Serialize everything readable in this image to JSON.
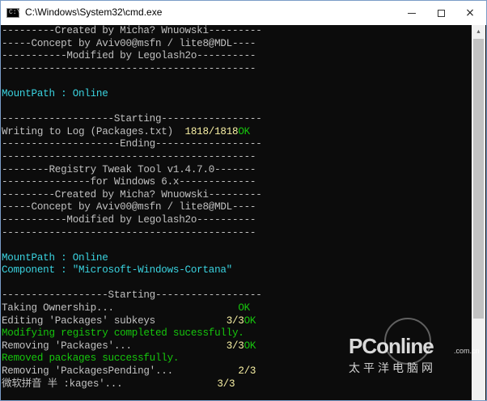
{
  "window": {
    "title": "C:\\Windows\\System32\\cmd.exe",
    "icon": "cmd-icon"
  },
  "controls": {
    "minimize": "minimize-icon",
    "maximize": "maximize-icon",
    "close": "×"
  },
  "colors": {
    "grey": "#c0c0c0",
    "cyan": "#3ad3e0",
    "green": "#16c60c",
    "yellow": "#f9f1a5"
  },
  "console_lines": [
    {
      "segments": [
        {
          "text": "---------Created by Micha? Wnuowski---------",
          "color": "grey"
        }
      ]
    },
    {
      "segments": [
        {
          "text": "-----Concept by Aviv00@msfn / lite8@MDL----",
          "color": "grey"
        }
      ]
    },
    {
      "segments": [
        {
          "text": "-----------Modified by Legolash2o----------",
          "color": "grey"
        }
      ]
    },
    {
      "segments": [
        {
          "text": "-------------------------------------------",
          "color": "grey"
        }
      ]
    },
    {
      "segments": [
        {
          "text": "",
          "color": "grey"
        }
      ]
    },
    {
      "segments": [
        {
          "text": "MountPath : Online",
          "color": "cyan"
        }
      ]
    },
    {
      "segments": [
        {
          "text": "",
          "color": "grey"
        }
      ]
    },
    {
      "segments": [
        {
          "text": "-------------------Starting-----------------",
          "color": "grey"
        }
      ]
    },
    {
      "segments": [
        {
          "text": "Writing to Log (Packages.txt)  ",
          "color": "grey"
        },
        {
          "text": "1818/1818",
          "color": "yellow"
        },
        {
          "text": "OK",
          "color": "green"
        }
      ]
    },
    {
      "segments": [
        {
          "text": "--------------------Ending------------------",
          "color": "grey"
        }
      ]
    },
    {
      "segments": [
        {
          "text": "-------------------------------------------",
          "color": "grey"
        }
      ]
    },
    {
      "segments": [
        {
          "text": "--------Registry Tweak Tool v1.4.7.0-------",
          "color": "grey"
        }
      ]
    },
    {
      "segments": [
        {
          "text": "---------------for Windows 6.x-------------",
          "color": "grey"
        }
      ]
    },
    {
      "segments": [
        {
          "text": "---------Created by Micha? Wnuowski---------",
          "color": "grey"
        }
      ]
    },
    {
      "segments": [
        {
          "text": "-----Concept by Aviv00@msfn / lite8@MDL----",
          "color": "grey"
        }
      ]
    },
    {
      "segments": [
        {
          "text": "-----------Modified by Legolash2o----------",
          "color": "grey"
        }
      ]
    },
    {
      "segments": [
        {
          "text": "-------------------------------------------",
          "color": "grey"
        }
      ]
    },
    {
      "segments": [
        {
          "text": "",
          "color": "grey"
        }
      ]
    },
    {
      "segments": [
        {
          "text": "MountPath : Online",
          "color": "cyan"
        }
      ]
    },
    {
      "segments": [
        {
          "text": "Component : \"Microsoft-Windows-Cortana\"",
          "color": "cyan"
        }
      ]
    },
    {
      "segments": [
        {
          "text": "",
          "color": "grey"
        }
      ]
    },
    {
      "segments": [
        {
          "text": "------------------Starting------------------",
          "color": "grey"
        }
      ]
    },
    {
      "segments": [
        {
          "text": "Taking Ownership...                     ",
          "color": "grey"
        },
        {
          "text": "OK",
          "color": "green"
        }
      ]
    },
    {
      "segments": [
        {
          "text": "Editing 'Packages' subkeys            ",
          "color": "grey"
        },
        {
          "text": "3/3",
          "color": "yellow"
        },
        {
          "text": "OK",
          "color": "green"
        }
      ]
    },
    {
      "segments": [
        {
          "text": "Modifying registry completed sucessfully.",
          "color": "green"
        }
      ]
    },
    {
      "segments": [
        {
          "text": "Removing 'Packages'...                ",
          "color": "grey"
        },
        {
          "text": "3/3",
          "color": "yellow"
        },
        {
          "text": "OK",
          "color": "green"
        }
      ]
    },
    {
      "segments": [
        {
          "text": "Removed packages successfully.",
          "color": "green"
        }
      ]
    },
    {
      "segments": [
        {
          "text": "Removing 'PackagesPending'...           ",
          "color": "grey"
        },
        {
          "text": "2/3",
          "color": "yellow"
        }
      ]
    },
    {
      "segments": [
        {
          "text": "微软拼音 半 :kages'...                ",
          "color": "grey"
        },
        {
          "text": "3/3",
          "color": "yellow"
        }
      ]
    }
  ],
  "watermark": {
    "logo": "PConline",
    "domain": ".com.cn",
    "cn": "太平洋电脑网"
  }
}
